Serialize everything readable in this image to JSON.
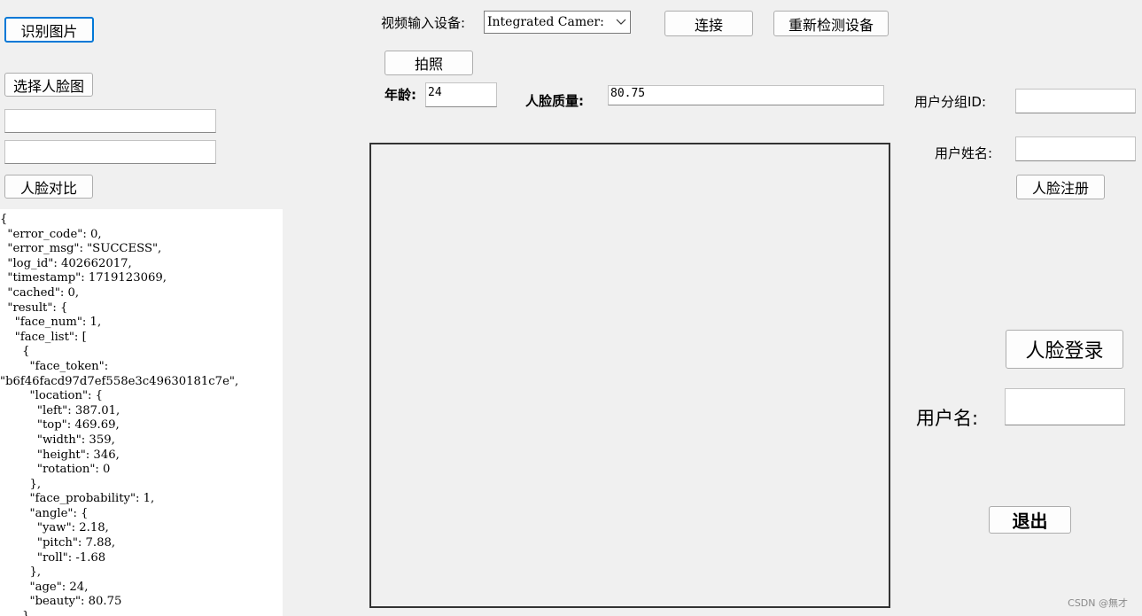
{
  "left_panel": {
    "recognize_button": "识别图片",
    "select_face_button": "选择人脸图",
    "path_field_1": "",
    "path_field_2": "",
    "compare_button": "人脸对比",
    "json_output": "{\n  \"error_code\": 0,\n  \"error_msg\": \"SUCCESS\",\n  \"log_id\": 402662017,\n  \"timestamp\": 1719123069,\n  \"cached\": 0,\n  \"result\": {\n    \"face_num\": 1,\n    \"face_list\": [\n      {\n        \"face_token\":\n\"b6f46facd97d7ef558e3c49630181c7e\",\n        \"location\": {\n          \"left\": 387.01,\n          \"top\": 469.69,\n          \"width\": 359,\n          \"height\": 346,\n          \"rotation\": 0\n        },\n        \"face_probability\": 1,\n        \"angle\": {\n          \"yaw\": 2.18,\n          \"pitch\": 7.88,\n          \"roll\": -1.68\n        },\n        \"age\": 24,\n        \"beauty\": 80.75\n      }"
  },
  "top_bar": {
    "device_label": "视频输入设备:",
    "device_selected": "Integrated Camer:",
    "connect_button": "连接",
    "redetect_button": "重新检测设备",
    "capture_button": "拍照"
  },
  "info": {
    "age_label": "年龄:",
    "age_value": "24",
    "quality_label": "人脸质量:",
    "quality_value": "80.75"
  },
  "right_panel": {
    "group_id_label": "用户分组ID:",
    "group_id_value": "",
    "user_name_label": "用户姓名:",
    "user_name_value": "",
    "register_button": "人脸注册",
    "login_button": "人脸登录",
    "username_label": "用户名:",
    "username_value": "",
    "exit_button": "退出"
  },
  "watermark": "CSDN @無才"
}
